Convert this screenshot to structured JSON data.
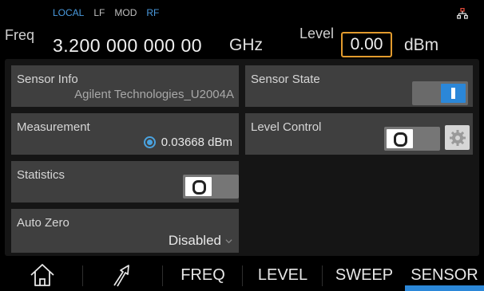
{
  "status": {
    "indicators": [
      {
        "label": "LOCAL",
        "active": true
      },
      {
        "label": "LF",
        "active": false
      },
      {
        "label": "MOD",
        "active": false
      },
      {
        "label": "RF",
        "active": true
      }
    ],
    "network_icon": "network-icon"
  },
  "header": {
    "freq_label": "Freq",
    "freq_value": "3.200 000 000 00",
    "freq_unit": "GHz",
    "level_label": "Level",
    "level_value": "0.00",
    "level_unit": "dBm"
  },
  "sensor_info": {
    "title": "Sensor Info",
    "value": "Agilent Technologies_U2004A"
  },
  "sensor_state": {
    "title": "Sensor State",
    "toggle": "on"
  },
  "measurement": {
    "title": "Measurement",
    "value": "0.03668 dBm"
  },
  "level_control": {
    "title": "Level Control",
    "toggle": "off",
    "settings_icon": "gear-icon"
  },
  "statistics": {
    "title": "Statistics",
    "toggle": "off"
  },
  "auto_zero": {
    "title": "Auto Zero",
    "value": "Disabled"
  },
  "nav": {
    "home_icon": "home-icon",
    "back_icon": "arrow-icon",
    "items": [
      "FREQ",
      "LEVEL",
      "SWEEP",
      "SENSOR"
    ],
    "active": "SENSOR"
  },
  "colors": {
    "accent": "#2b87d8",
    "highlight": "#e29b2e",
    "indicator": "#4a9ade"
  }
}
